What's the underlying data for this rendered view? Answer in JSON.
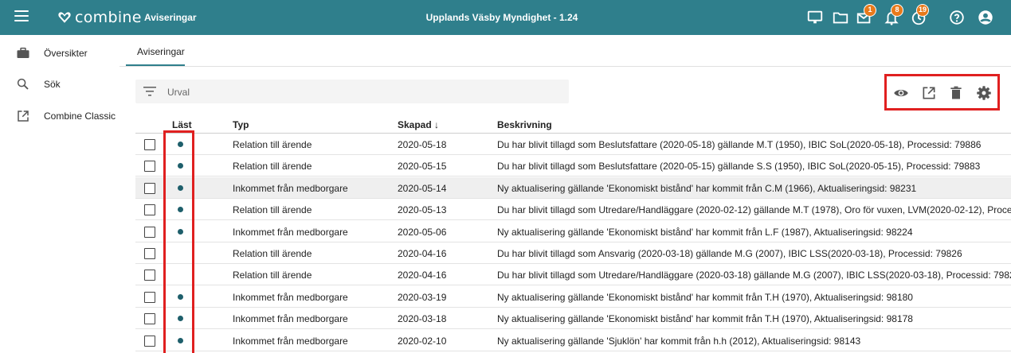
{
  "topbar": {
    "brand": "combine",
    "app_title": "Aviseringar",
    "center_title": "Upplands Väsby Myndighet - 1.24",
    "icons": [
      {
        "name": "monitor-icon",
        "badge": ""
      },
      {
        "name": "folder-icon",
        "badge": ""
      },
      {
        "name": "mail-icon",
        "badge": "1"
      },
      {
        "name": "bell-icon",
        "badge": "8"
      },
      {
        "name": "clock-icon",
        "badge": "19"
      },
      {
        "name": "help-icon",
        "badge": ""
      },
      {
        "name": "account-icon",
        "badge": ""
      }
    ],
    "color": "#2f7f8c"
  },
  "sidebar": {
    "items": [
      {
        "label": "Översikter",
        "icon": "briefcase-icon"
      },
      {
        "label": "Sök",
        "icon": "search-icon"
      },
      {
        "label": "Combine Classic",
        "icon": "open-external-icon"
      }
    ]
  },
  "main": {
    "tab_label": "Aviseringar",
    "filter_label": "Urval",
    "actions": [
      "eye-icon",
      "open-external-icon",
      "trash-icon",
      "gear-icon"
    ]
  },
  "table": {
    "columns": {
      "read": "Läst",
      "type": "Typ",
      "created": "Skapad ↓",
      "description": "Beskrivning"
    },
    "rows": [
      {
        "read": true,
        "type": "Relation till ärende",
        "created": "2020-05-18",
        "description": "Du har blivit tillagd som Beslutsfattare (2020-05-18) gällande M.T (1950), IBIC SoL(2020-05-18), Processid: 79886"
      },
      {
        "read": true,
        "type": "Relation till ärende",
        "created": "2020-05-15",
        "description": "Du har blivit tillagd som Beslutsfattare (2020-05-15) gällande S.S (1950), IBIC SoL(2020-05-15), Processid: 79883"
      },
      {
        "read": true,
        "type": "Inkommet från medborgare",
        "created": "2020-05-14",
        "description": "Ny aktualisering gällande 'Ekonomiskt bistånd' har kommit från C.M (1966), Aktualiseringsid: 98231"
      },
      {
        "read": true,
        "type": "Relation till ärende",
        "created": "2020-05-13",
        "description": "Du har blivit tillagd som Utredare/Handläggare (2020-02-12) gällande M.T (1978), Oro för vuxen, LVM(2020-02-12), Proce..."
      },
      {
        "read": true,
        "type": "Inkommet från medborgare",
        "created": "2020-05-06",
        "description": "Ny aktualisering gällande 'Ekonomiskt bistånd' har kommit från L.F (1987), Aktualiseringsid: 98224"
      },
      {
        "read": false,
        "type": "Relation till ärende",
        "created": "2020-04-16",
        "description": "Du har blivit tillagd som Ansvarig (2020-03-18) gällande M.G (2007), IBIC LSS(2020-03-18), Processid: 79826"
      },
      {
        "read": false,
        "type": "Relation till ärende",
        "created": "2020-04-16",
        "description": "Du har blivit tillagd som Utredare/Handläggare (2020-03-18) gällande M.G (2007), IBIC LSS(2020-03-18), Processid: 7982"
      },
      {
        "read": true,
        "type": "Inkommet från medborgare",
        "created": "2020-03-19",
        "description": "Ny aktualisering gällande 'Ekonomiskt bistånd' har kommit från T.H (1970), Aktualiseringsid: 98180"
      },
      {
        "read": true,
        "type": "Inkommet från medborgare",
        "created": "2020-03-18",
        "description": "Ny aktualisering gällande 'Ekonomiskt bistånd' har kommit från T.H (1970), Aktualiseringsid: 98178"
      },
      {
        "read": true,
        "type": "Inkommet från medborgare",
        "created": "2020-02-10",
        "description": "Ny aktualisering gällande 'Sjuklön' har kommit från h.h (2012), Aktualiseringsid: 98143"
      }
    ],
    "highlight_row": 2
  }
}
